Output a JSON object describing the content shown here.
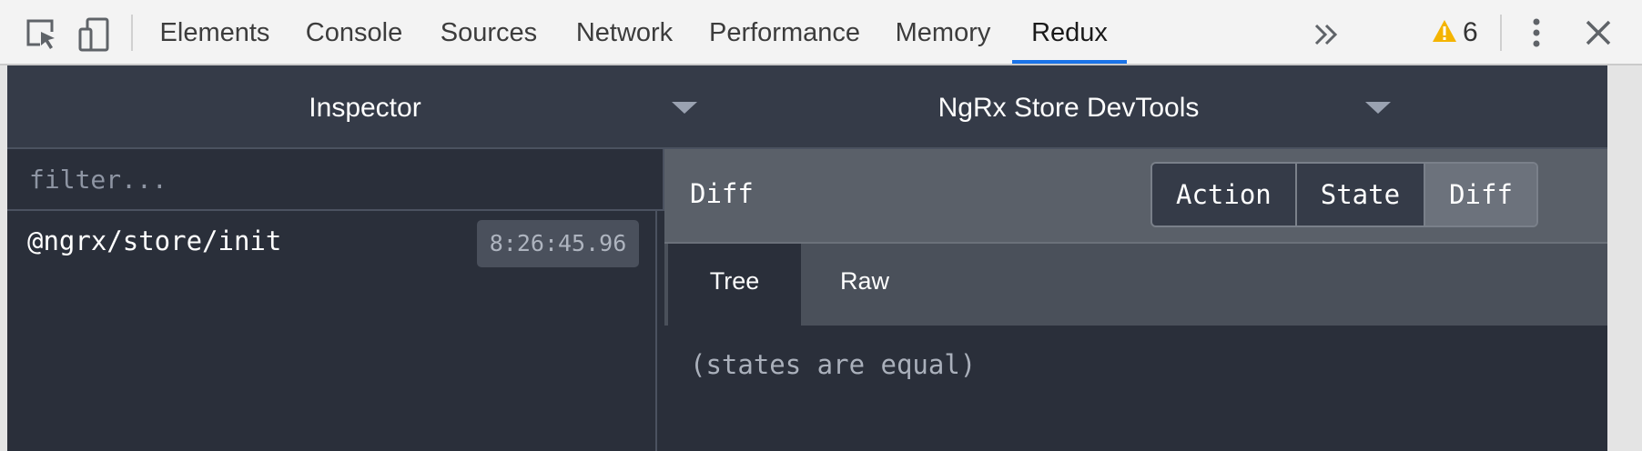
{
  "toolbar": {
    "tabs": [
      {
        "label": "Elements"
      },
      {
        "label": "Console"
      },
      {
        "label": "Sources"
      },
      {
        "label": "Network"
      },
      {
        "label": "Performance"
      },
      {
        "label": "Memory"
      },
      {
        "label": "Redux"
      }
    ],
    "active_tab": "Redux",
    "more_tabs_icon": "chevron-double-right-icon",
    "warning_count": "6",
    "accent_color": "#1a73e8"
  },
  "redux": {
    "monitor_select": {
      "value": "Inspector"
    },
    "instance_select": {
      "value": "NgRx Store DevTools"
    },
    "filter": {
      "placeholder": "filter...",
      "value": ""
    },
    "actions": [
      {
        "name": "@ngrx/store/init",
        "time": "8:26:45.96"
      }
    ],
    "diff_panel": {
      "title": "Diff",
      "tabs": [
        {
          "label": "Action"
        },
        {
          "label": "State"
        },
        {
          "label": "Diff"
        }
      ],
      "active_tab": "Diff",
      "sub_tabs": [
        {
          "label": "Tree"
        },
        {
          "label": "Raw"
        }
      ],
      "active_sub_tab": "Tree",
      "message": "(states are equal)"
    }
  }
}
